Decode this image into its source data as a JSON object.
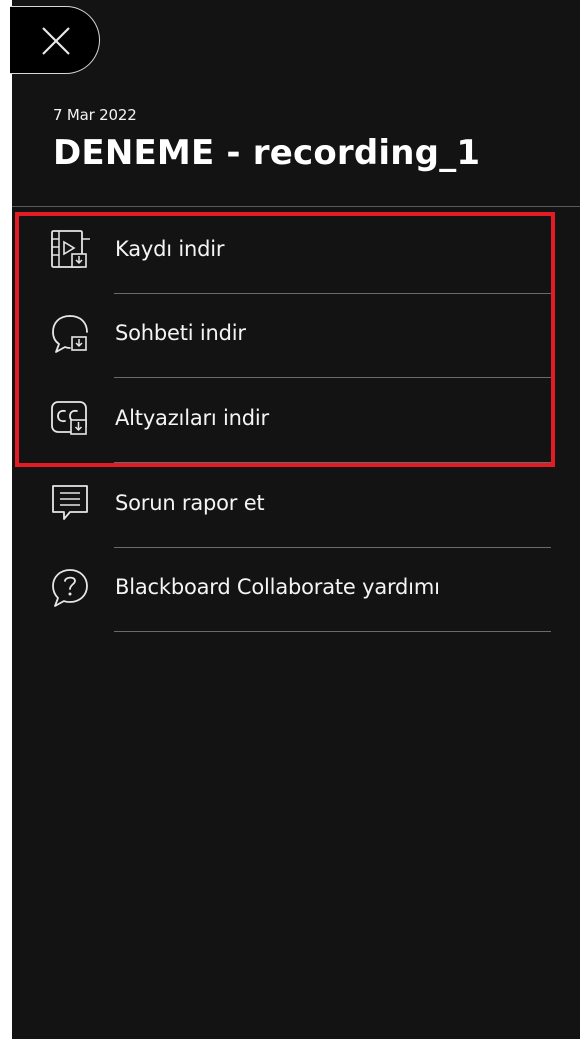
{
  "header": {
    "date": "7 Mar 2022",
    "title": "DENEME - recording_1"
  },
  "menu": {
    "items": [
      {
        "label": "Kaydı indir",
        "icon": "download-recording-icon"
      },
      {
        "label": "Sohbeti indir",
        "icon": "download-chat-icon"
      },
      {
        "label": "Altyazıları indir",
        "icon": "download-captions-icon"
      },
      {
        "label": "Sorun rapor et",
        "icon": "report-issue-icon"
      },
      {
        "label": "Blackboard Collaborate yardımı",
        "icon": "help-icon"
      }
    ]
  },
  "colors": {
    "panel_background": "#131313",
    "highlight": "#e21b24",
    "text": "#ffffff"
  }
}
